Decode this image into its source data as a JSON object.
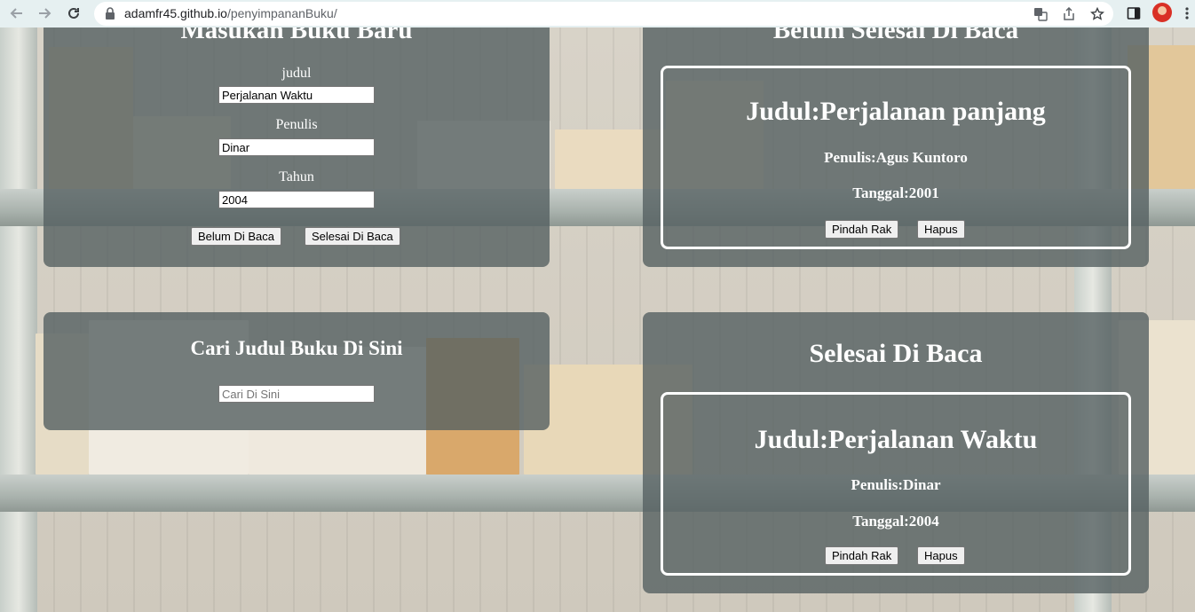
{
  "browser": {
    "url_host": "adamfr45.github.io",
    "url_path": "/penyimpananBuku/"
  },
  "add_book": {
    "title": "Masukan Buku Baru",
    "judul_label": "judul",
    "judul_value": "Perjalanan Waktu",
    "penulis_label": "Penulis",
    "penulis_value": "Dinar",
    "tahun_label": "Tahun",
    "tahun_value": "2004",
    "btn_unread": "Belum Di Baca",
    "btn_read": "Selesai Di Baca"
  },
  "search": {
    "title": "Cari Judul Buku Di Sini",
    "placeholder": "Cari Di Sini"
  },
  "unread_shelf": {
    "title": "Belum Selesai Di Baca",
    "books": [
      {
        "title": "Judul:Perjalanan panjang",
        "author": "Penulis:Agus Kuntoro",
        "year": "Tanggal:2001",
        "move_label": "Pindah Rak",
        "delete_label": "Hapus"
      }
    ]
  },
  "read_shelf": {
    "title": "Selesai Di Baca",
    "books": [
      {
        "title": "Judul:Perjalanan Waktu",
        "author": "Penulis:Dinar",
        "year": "Tanggal:2004",
        "move_label": "Pindah Rak",
        "delete_label": "Hapus"
      }
    ]
  },
  "colors": {
    "panel": "#556061",
    "card_border": "#ffffff",
    "chrome": "#e6f0f1"
  }
}
